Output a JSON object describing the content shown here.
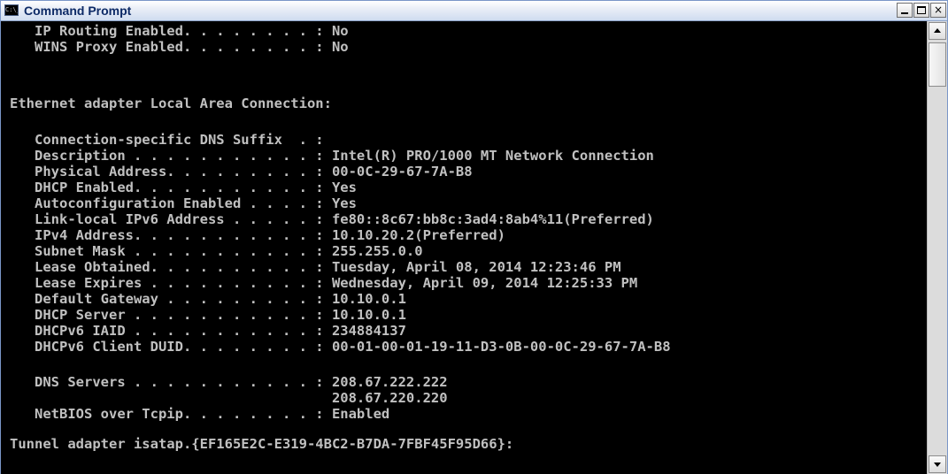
{
  "window": {
    "title": "Command Prompt",
    "icon_label": "C:\\_",
    "controls": {
      "minimize": "minimize-icon",
      "maximize": "maximize-icon",
      "close": "×"
    }
  },
  "console": {
    "foreground_color": "#c0c0c0",
    "background_color": "#000000",
    "lines": [
      "   IP Routing Enabled. . . . . . . . : No",
      "   WINS Proxy Enabled. . . . . . . . : No",
      "",
      "Ethernet adapter Local Area Connection:",
      "",
      "   Connection-specific DNS Suffix  . :",
      "   Description . . . . . . . . . . . : Intel(R) PRO/1000 MT Network Connection",
      "   Physical Address. . . . . . . . . : 00-0C-29-67-7A-B8",
      "   DHCP Enabled. . . . . . . . . . . : Yes",
      "   Autoconfiguration Enabled . . . . : Yes",
      "   Link-local IPv6 Address . . . . . : fe80::8c67:bb8c:3ad4:8ab4%11(Preferred)",
      "   IPv4 Address. . . . . . . . . . . : 10.10.20.2(Preferred)",
      "   Subnet Mask . . . . . . . . . . . : 255.255.0.0",
      "   Lease Obtained. . . . . . . . . . : Tuesday, April 08, 2014 12:23:46 PM",
      "   Lease Expires . . . . . . . . . . : Wednesday, April 09, 2014 12:25:33 PM",
      "   Default Gateway . . . . . . . . . : 10.10.0.1",
      "   DHCP Server . . . . . . . . . . . : 10.10.0.1",
      "   DHCPv6 IAID . . . . . . . . . . . : 234884137",
      "   DHCPv6 Client DUID. . . . . . . . : 00-01-00-01-19-11-D3-0B-00-0C-29-67-7A-B8",
      "",
      "   DNS Servers . . . . . . . . . . . : 208.67.222.222",
      "                                       208.67.220.220",
      "   NetBIOS over Tcpip. . . . . . . . : Enabled",
      "",
      "Tunnel adapter isatap.{EF165E2C-E319-4BC2-B7DA-7FBF45F95D66}:"
    ]
  },
  "scrollbar": {
    "up_icon": "scroll-up-arrow-icon",
    "down_icon": "scroll-down-arrow-icon"
  }
}
